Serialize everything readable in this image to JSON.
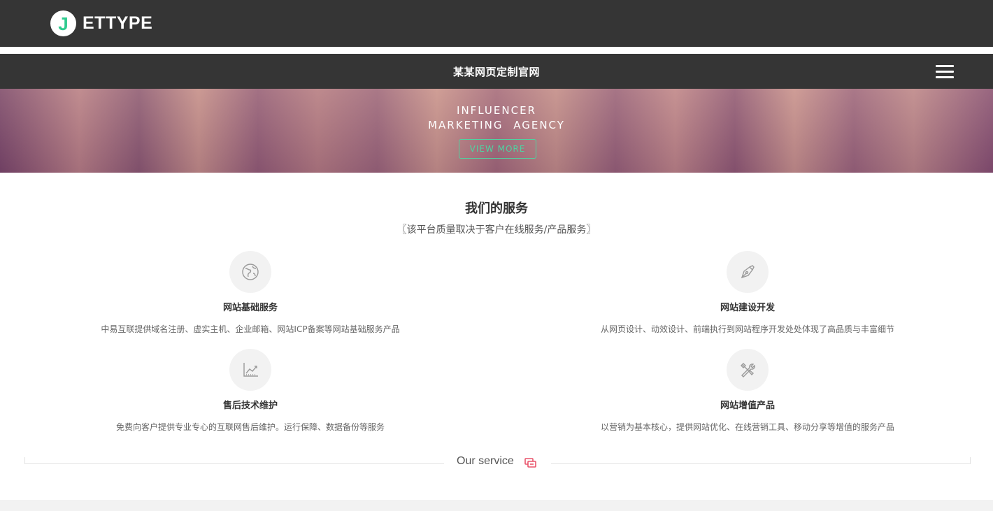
{
  "brand": {
    "logo_letter": "J",
    "logo_text": "ETTYPE",
    "accent_color": "#2fcb8f"
  },
  "nav": {
    "site_title": "某某网页定制官网",
    "menu_icon": "hamburger-menu-icon"
  },
  "hero": {
    "line1": "INFLUENCER",
    "line2": "MARKETING AGENCY",
    "button_label": "VIEW MORE",
    "button_color": "#4fd3a1"
  },
  "services": {
    "title": "我们的服务",
    "subtitle": "〖该平台质量取决于客户在线服务/产品服务〗",
    "items": [
      {
        "icon": "globe-icon",
        "title": "网站基础服务",
        "desc": "中易互联提供域名注册、虚实主机、企业邮箱、网站ICP备案等网站基础服务产品"
      },
      {
        "icon": "pen-icon",
        "title": "网站建设开发",
        "desc": "从网页设计、动效设计、前端执行到网站程序开发处处体现了高品质与丰富细节"
      },
      {
        "icon": "chart-icon",
        "title": "售后技术维护",
        "desc": "免费向客户提供专业专心的互联网售后维护。运行保障、数据备份等服务"
      },
      {
        "icon": "tools-icon",
        "title": "网站增值产品",
        "desc": "以营销为基本核心，提供网站优化、在线营销工具、移动分享等增值的服务产品"
      }
    ]
  },
  "divider": {
    "label": "Our service",
    "icon": "windows-icon",
    "icon_color": "#e9546b"
  },
  "colors": {
    "dark_bar": "#353535",
    "footer_strip": "#f2f2f2"
  }
}
